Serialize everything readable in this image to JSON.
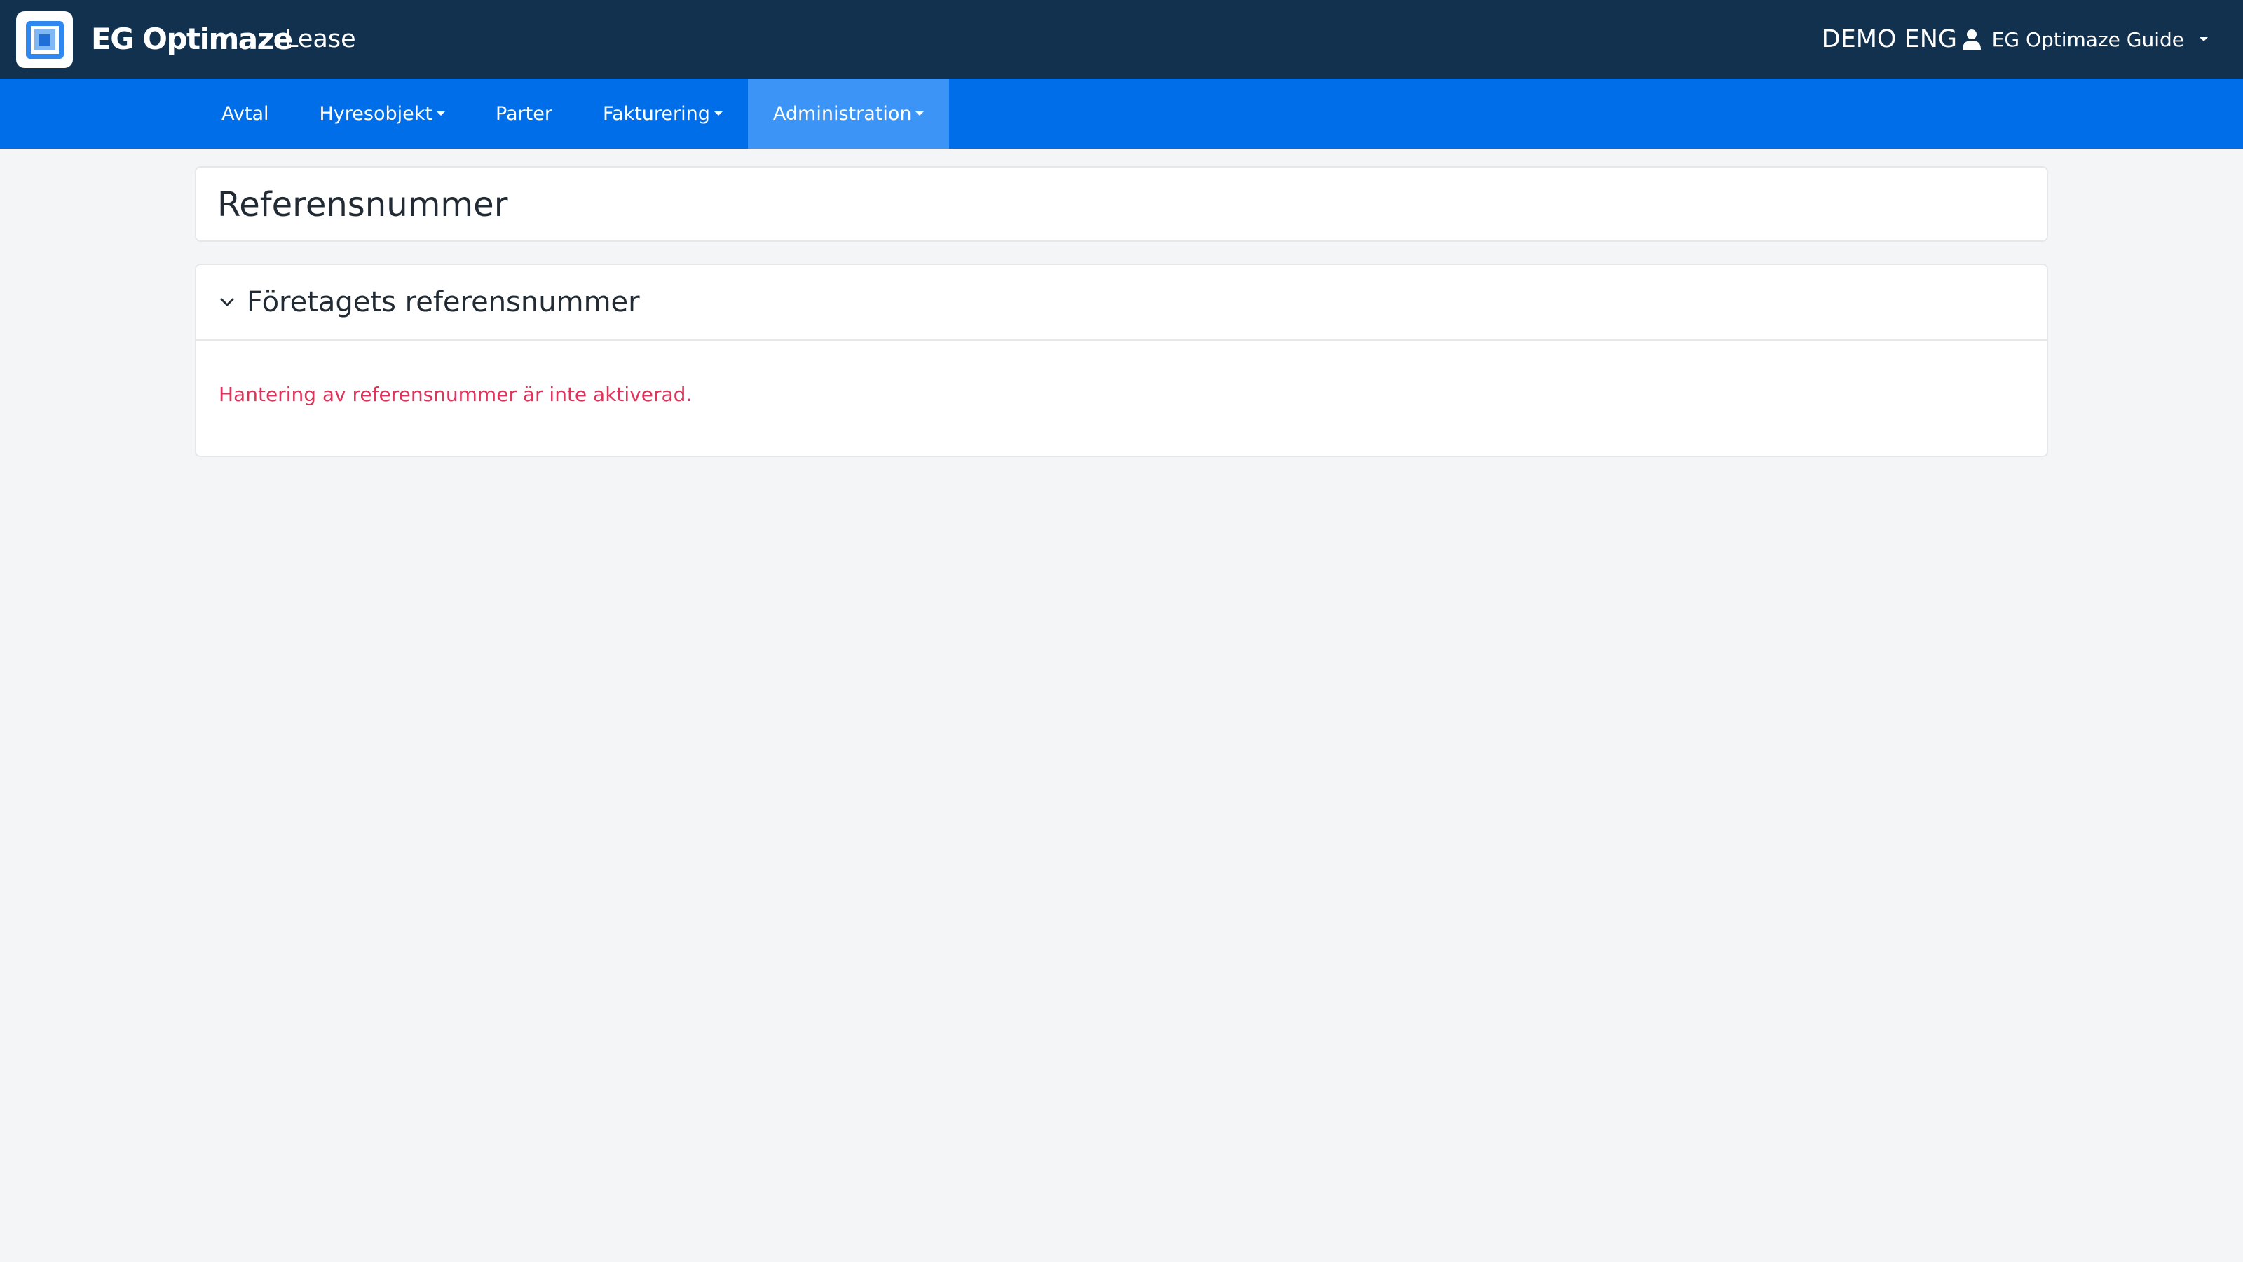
{
  "header": {
    "brand": "EG Optimaze",
    "app_name": "Lease",
    "environment": "DEMO ENG",
    "user_name": "EG Optimaze Guide",
    "logo_icon": "eg-logo-icon",
    "user_icon": "user-icon"
  },
  "nav": {
    "items": [
      {
        "label": "Avtal",
        "dropdown": false,
        "active": false
      },
      {
        "label": "Hyresobjekt",
        "dropdown": true,
        "active": false
      },
      {
        "label": "Parter",
        "dropdown": false,
        "active": false
      },
      {
        "label": "Fakturering",
        "dropdown": true,
        "active": false
      },
      {
        "label": "Administration",
        "dropdown": true,
        "active": true
      }
    ]
  },
  "page": {
    "title": "Referensnummer"
  },
  "section": {
    "title": "Företagets referensnummer",
    "expanded": true,
    "message": "Hantering av referensnummer är inte aktiverad.",
    "toggle_icon": "chevron-down-icon"
  },
  "colors": {
    "header_bg": "#12314f",
    "nav_bg": "#006ee9",
    "nav_active_bg": "#3d94f7",
    "page_bg": "#f4f5f7",
    "message_text": "#e0335a"
  }
}
